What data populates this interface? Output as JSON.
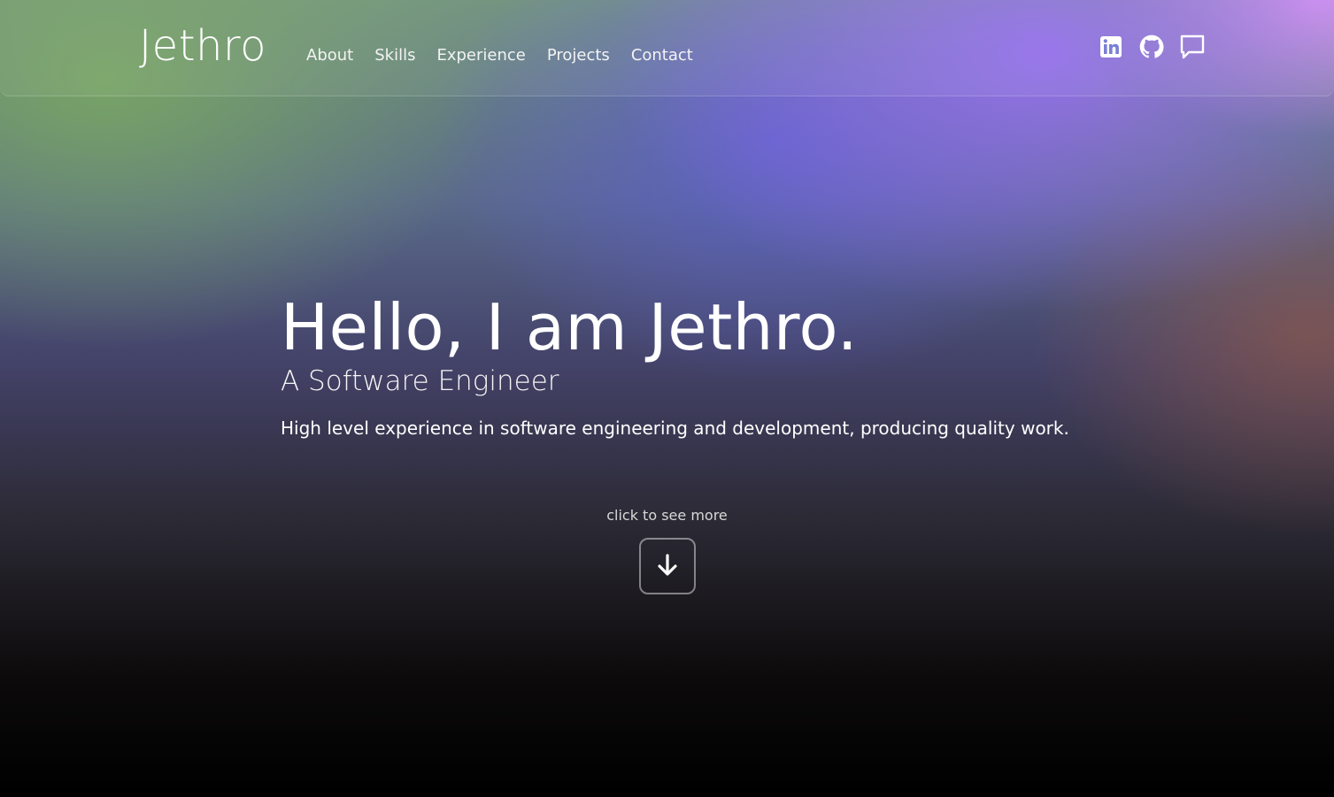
{
  "header": {
    "brand": "Jethro",
    "nav": [
      {
        "label": "About"
      },
      {
        "label": "Skills"
      },
      {
        "label": "Experience"
      },
      {
        "label": "Projects"
      },
      {
        "label": "Contact"
      }
    ],
    "socials": [
      {
        "icon": "linkedin-icon"
      },
      {
        "icon": "github-icon"
      },
      {
        "icon": "chat-bubble-icon"
      }
    ]
  },
  "hero": {
    "title": "Hello, I am Jethro.",
    "subtitle": "A Software Engineer",
    "description": "High level experience in software engineering and development, producing quality work."
  },
  "scroll_cta": {
    "label": "click to see more",
    "icon": "arrow-down-icon"
  },
  "colors": {
    "text": "#ffffff",
    "muted_text": "#d8d8d8",
    "button_border": "rgba(255,255,255,0.45)"
  }
}
